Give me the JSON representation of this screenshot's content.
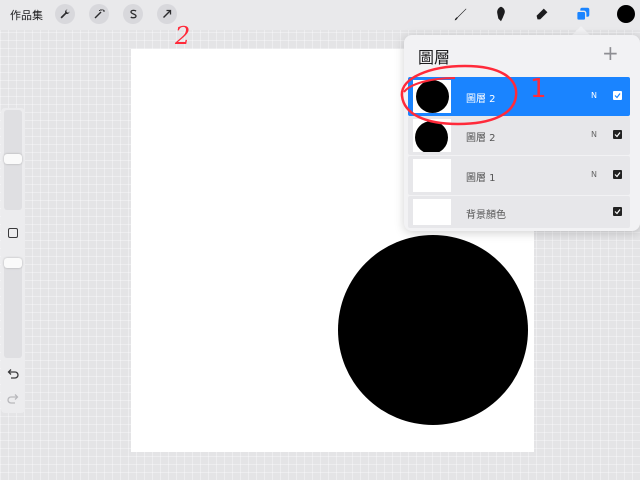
{
  "topbar": {
    "gallery_label": "作品集",
    "tools_left": [
      {
        "icon": "wrench-icon"
      },
      {
        "icon": "magic-wand-icon"
      },
      {
        "icon": "selection-s-icon"
      },
      {
        "icon": "transform-arrow-icon"
      }
    ],
    "tools_right": [
      {
        "icon": "brush-icon"
      },
      {
        "icon": "smudge-icon"
      },
      {
        "icon": "eraser-icon"
      },
      {
        "icon": "layers-icon",
        "active": true
      }
    ],
    "current_color": "#000000"
  },
  "annotations": {
    "number_1": "1",
    "number_2": "2",
    "color": "#ff2a3a"
  },
  "layers_panel": {
    "title": "圖層",
    "add_label": "+",
    "layers": [
      {
        "name": "圖層 2",
        "blend": "N",
        "visible": true,
        "selected": true
      },
      {
        "name": "圖層 2",
        "blend": "N",
        "visible": true,
        "selected": false
      },
      {
        "name": "圖層 1",
        "blend": "N",
        "visible": true,
        "selected": false
      },
      {
        "name": "背景顏色",
        "blend": "",
        "visible": true,
        "selected": false
      }
    ]
  },
  "colors": {
    "accent": "#1a84ff",
    "canvas": "#ffffff",
    "ink": "#000000"
  }
}
